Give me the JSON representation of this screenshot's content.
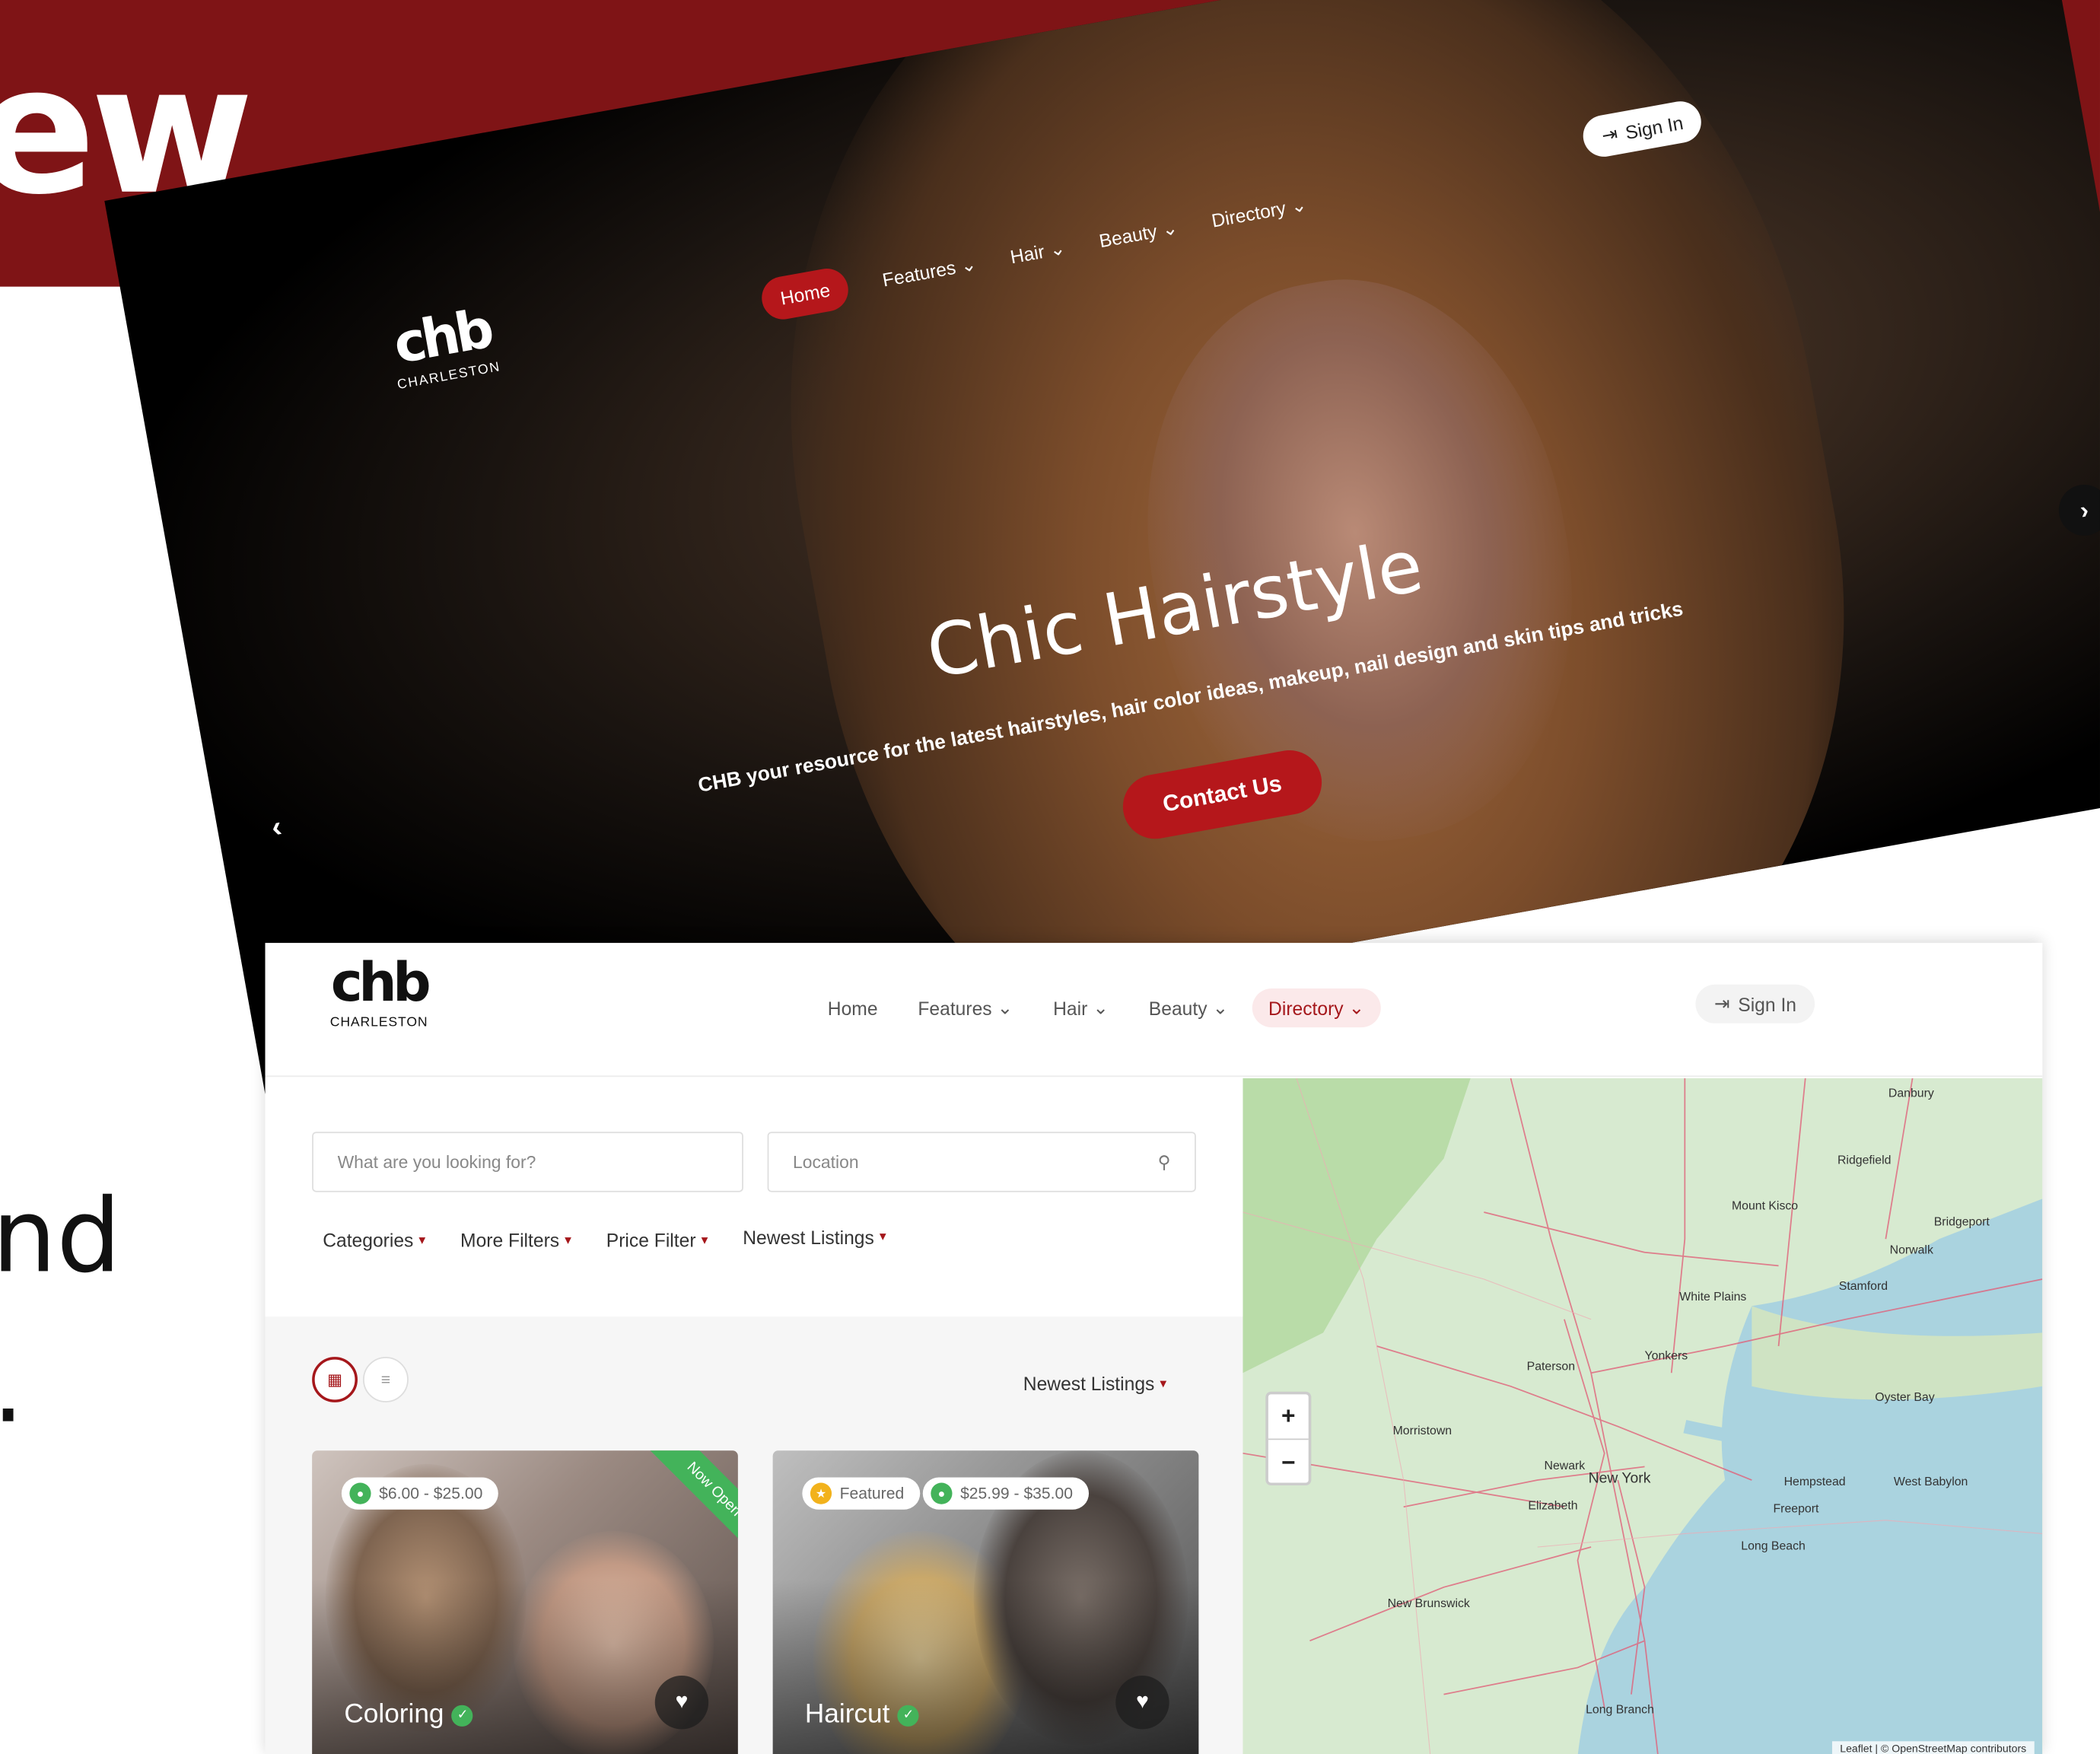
{
  "background": {
    "big_word": "ew",
    "fragment_1": "nd",
    "fragment_2": "."
  },
  "hero": {
    "logo_mark": "chb",
    "logo_sub": "CHARLESTON",
    "nav": [
      "Home",
      "Features",
      "Hair",
      "Beauty",
      "Directory"
    ],
    "active_nav": "Home",
    "sign_in": "Sign In",
    "title": "Chic Hairstyle",
    "subtitle": "CHB your resource for the latest hairstyles, hair color ideas, makeup, nail design and skin tips and tricks",
    "cta": "Contact Us"
  },
  "directory": {
    "logo_mark": "chb",
    "logo_sub": "CHARLESTON",
    "nav": [
      "Home",
      "Features",
      "Hair",
      "Beauty",
      "Directory"
    ],
    "active_nav": "Directory",
    "sign_in": "Sign In",
    "search_placeholder": "What are you looking for?",
    "location_placeholder": "Location",
    "filters": [
      "Categories",
      "More Filters",
      "Price Filter",
      "Newest Listings"
    ],
    "sort_label": "Newest Listings",
    "cards": [
      {
        "name": "Coloring",
        "price": "$6.00 - $25.00",
        "ribbon": "Now Open"
      },
      {
        "name": "Haircut",
        "featured": "Featured",
        "price": "$25.99 - $35.00"
      }
    ]
  },
  "map": {
    "labels": [
      "Danbury",
      "New York",
      "Paterson",
      "Stamford",
      "Bridgeport",
      "Yonkers",
      "Newark",
      "Elizabeth",
      "New Brunswick",
      "Morristown",
      "Long Branch",
      "Norwalk",
      "Hempstead",
      "Freeport",
      "Long Beach",
      "Mount Kisco",
      "White Plains",
      "Ridgefield",
      "Oyster Bay",
      "West Babylon"
    ],
    "zoom_in": "+",
    "zoom_out": "−",
    "attribution": "Leaflet | © OpenStreetMap contributors",
    "colors": {
      "land": "#cfe6c4",
      "water": "#aad3df",
      "roads": "#e0627a"
    }
  }
}
